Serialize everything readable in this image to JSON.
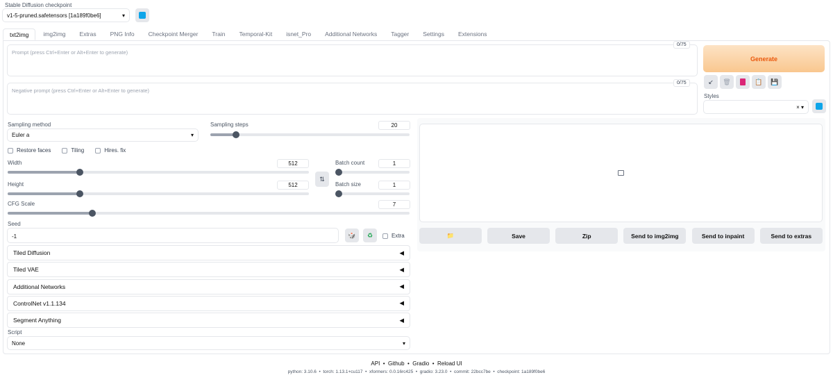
{
  "checkpoint": {
    "label": "Stable Diffusion checkpoint",
    "value": "v1-5-pruned.safetensors [1a189f0be6]"
  },
  "tabs": [
    "txt2img",
    "img2img",
    "Extras",
    "PNG Info",
    "Checkpoint Merger",
    "Train",
    "Temporal-Kit",
    "isnet_Pro",
    "Additional Networks",
    "Tagger",
    "Settings",
    "Extensions"
  ],
  "prompt": {
    "placeholder": "Prompt (press Ctrl+Enter or Alt+Enter to generate)",
    "count": "0/75"
  },
  "negative": {
    "placeholder": "Negative prompt (press Ctrl+Enter or Alt+Enter to generate)",
    "count": "0/75"
  },
  "generate": "Generate",
  "styles": {
    "label": "Styles",
    "clear": "×"
  },
  "sampling": {
    "method_label": "Sampling method",
    "method": "Euler a",
    "steps_label": "Sampling steps",
    "steps": "20",
    "steps_frac": 0.13
  },
  "checks": [
    "Restore faces",
    "Tiling",
    "Hires. fix"
  ],
  "width": {
    "label": "Width",
    "value": "512",
    "frac": 0.24
  },
  "height": {
    "label": "Height",
    "value": "512",
    "frac": 0.24
  },
  "batch_count": {
    "label": "Batch count",
    "value": "1",
    "frac": 0
  },
  "batch_size": {
    "label": "Batch size",
    "value": "1",
    "frac": 0
  },
  "cfg": {
    "label": "CFG Scale",
    "value": "7",
    "frac": 0.21
  },
  "seed": {
    "label": "Seed",
    "value": "-1",
    "extra": "Extra"
  },
  "accordions": [
    "Tiled Diffusion",
    "Tiled VAE",
    "Additional Networks",
    "ControlNet v1.1.134",
    "Segment Anything"
  ],
  "script": {
    "label": "Script",
    "value": "None"
  },
  "output_buttons": [
    "Save",
    "Zip",
    "Send to img2img",
    "Send to inpaint",
    "Send to extras"
  ],
  "footer": {
    "links": [
      "API",
      "Github",
      "Gradio",
      "Reload UI"
    ],
    "info": [
      "python: 3.10.6",
      "torch: 1.13.1+cu117",
      "xformers: 0.0.16rc425",
      "gradio: 3.23.0",
      "commit: 22bcc7be",
      "checkpoint: 1a189f0be6"
    ]
  },
  "colors": {
    "generate_bg": "#fdd9b0",
    "generate_text": "#ea580c",
    "refresh": "#0ea5e9"
  }
}
